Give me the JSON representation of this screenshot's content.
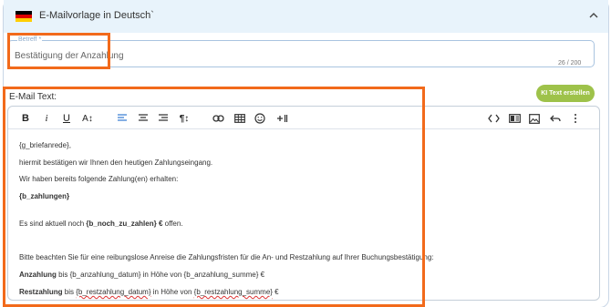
{
  "header": {
    "title": "E-Mailvorlage in Deutsch`",
    "flag_colors": [
      "#000000",
      "#dd0000",
      "#ffce00"
    ]
  },
  "subject": {
    "label": "Betreff *",
    "value": "Bestätigung der Anzahlung",
    "counter": "26 / 200"
  },
  "mail": {
    "label": "E-Mail Text:",
    "ai_button": "KI Text erstellen"
  },
  "toolbar": {
    "bold": "B",
    "italic": "i",
    "underline": "U",
    "font_size": "A↕",
    "paragraph": "¶↕",
    "icons": [
      "bold-icon",
      "italic-icon",
      "underline-icon",
      "font-size-icon",
      "align-left-icon",
      "align-center-icon",
      "align-right-icon",
      "paragraph-format-icon",
      "link-icon",
      "table-icon",
      "emoji-icon",
      "insert-plus-icon",
      "code-view-icon",
      "block-icon",
      "image-icon",
      "undo-icon",
      "more-icon"
    ]
  },
  "body": {
    "l1": "{g_briefanrede},",
    "l2": "hiermit bestätigen wir Ihnen den heutigen Zahlungseingang.",
    "l3": "Wir haben bereits folgende Zahlung(en) erhalten:",
    "l4": "{b_zahlungen}",
    "l5a": "Es sind aktuell noch ",
    "l5b": "{b_noch_zu_zahlen} €",
    "l5c": " offen.",
    "l6": "Bitte beachten Sie für eine reibungslose Anreise die Zahlungsfristen für die An- und Restzahlung auf Ihrer Buchungsbestätigung:",
    "l7a": "Anzahlung",
    "l7b": " bis {b_anzahlung_datum} in Höhe von {b_anzahlung_summe} €",
    "l8a": "Restzahlung",
    "l8b": " bis ",
    "l8c": "{b_restzahlung_datum}",
    "l8d": " in Höhe von ",
    "l8e": "{b_restzahlung_summe}",
    "l8f": " €"
  },
  "colors": {
    "accent_green": "#9ec24a",
    "highlight_orange": "#f26a1b",
    "active_align_blue": "#3b7fd4"
  }
}
